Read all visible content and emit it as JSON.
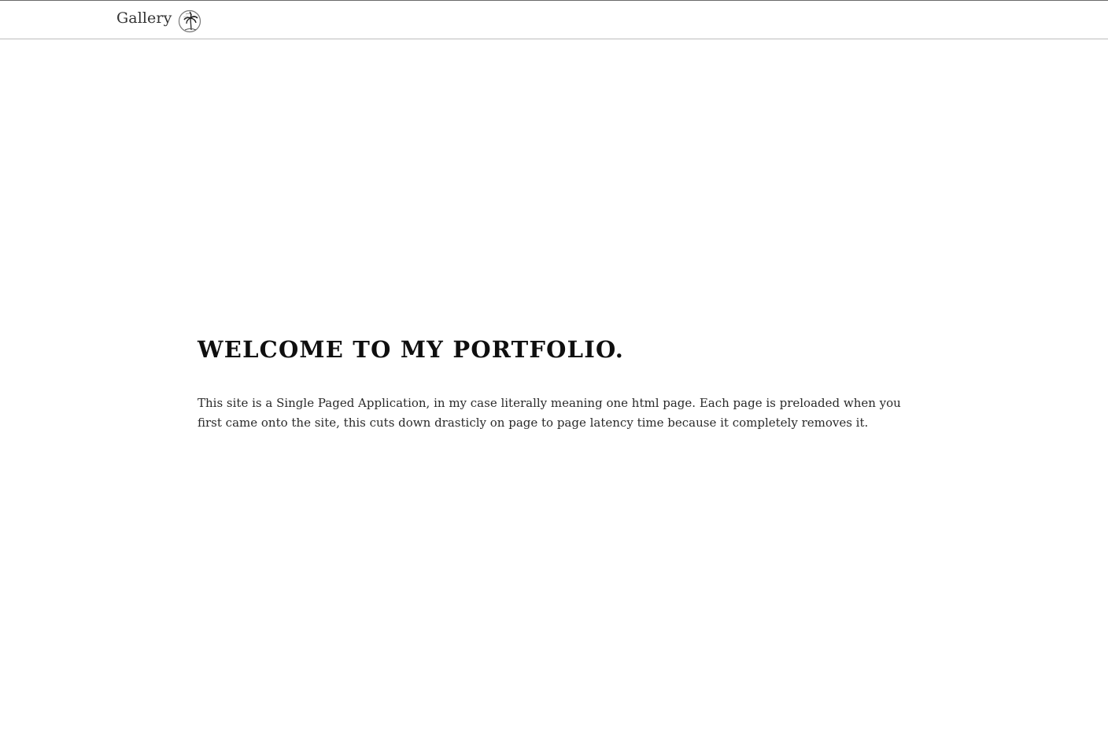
{
  "nav": {
    "gallery_label": "Gallery",
    "logo_icon": "palm-tree-globe-icon"
  },
  "main": {
    "title": "WELCOME TO MY PORTFOLIO.",
    "intro": "This site is a Single Paged Application, in my case literally meaning one html page. Each page is preloaded when you first came onto the site, this cuts down drasticly on page to page latency time because it completely removes it."
  },
  "colors": {
    "background": "#ffffff",
    "text": "#1a1a1a",
    "border": "#bdbdbd"
  }
}
